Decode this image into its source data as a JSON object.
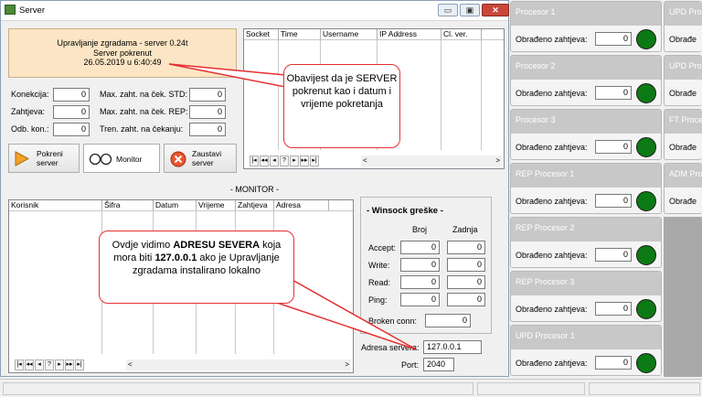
{
  "window": {
    "title": "Server",
    "minimize": "▭",
    "maximize": "▣",
    "close": "✕"
  },
  "status": {
    "line1": "Upravljanje zgradama - server 0.24t",
    "line2": "Server pokrenut",
    "line3": "26.05.2019 u  6:40:49"
  },
  "counters": {
    "konekcija_label": "Konekcija:",
    "konekcija": "0",
    "zahtjeva_label": "Zahtjeva:",
    "zahtjeva": "0",
    "odb_label": "Odb. kon.:",
    "odb": "0",
    "max_std_label": "Max. zaht. na ček. STD:",
    "max_std": "0",
    "max_rep_label": "Max. zaht. na ček. REP:",
    "max_rep": "0",
    "tren_label": "Tren. zaht. na čekanju:",
    "tren": "0"
  },
  "buttons": {
    "start": "Pokreni server",
    "monitor": "Monitor",
    "stop": "Zaustavi server"
  },
  "socket_grid": {
    "columns": [
      "Socket",
      "Time",
      "Username",
      "IP Address",
      "Cl. ver."
    ]
  },
  "monitor": {
    "title": "- MONITOR -",
    "columns": [
      "Korisnik",
      "Šifra",
      "Datum",
      "Vrijeme",
      "Zahtjeva",
      "Adresa"
    ]
  },
  "navigator": [
    "|◂",
    "◂◂",
    "◂",
    "?",
    "▸",
    "▸▸",
    "▸|"
  ],
  "winsock": {
    "title": "- Winsock greške -",
    "col_broj": "Broj",
    "col_zadnja": "Zadnja",
    "rows": [
      {
        "label": "Accept:",
        "broj": "0",
        "zadnja": "0"
      },
      {
        "label": "Write:",
        "broj": "0",
        "zadnja": "0"
      },
      {
        "label": "Read:",
        "broj": "0",
        "zadnja": "0"
      },
      {
        "label": "Ping:",
        "broj": "0",
        "zadnja": "0"
      }
    ],
    "broken_label": "Broken conn:",
    "broken": "0"
  },
  "server_address": {
    "label": "Adresa servera:",
    "value": "127.0.0.1",
    "port_label": "Port:",
    "port": "2040"
  },
  "callouts": {
    "top": "Obavijest da je SERVER pokrenut kao i datum i vrijeme pokretanja",
    "bottom_pre": "Ovdje vidimo ",
    "bottom_bold1": "ADRESU SEVERA",
    "bottom_mid": " koja mora biti ",
    "bottom_bold2": "127.0.0.1",
    "bottom_post": " ako je Upravljanje zgradama instalirano lokalno"
  },
  "processors_col1": [
    {
      "name": "Procesor 1",
      "label": "Obrađeno zahtjeva:",
      "value": "0"
    },
    {
      "name": "Procesor 2",
      "label": "Obrađeno zahtjeva:",
      "value": "0"
    },
    {
      "name": "Procesor 3",
      "label": "Obrađeno zahtjeva:",
      "value": "0"
    },
    {
      "name": "REP Procesor 1",
      "label": "Obrađeno zahtjeva:",
      "value": "0"
    },
    {
      "name": "REP Procesor 2",
      "label": "Obrađeno zahtjeva:",
      "value": "0"
    },
    {
      "name": "REP Procesor 3",
      "label": "Obrađeno zahtjeva:",
      "value": "0"
    },
    {
      "name": "UPD Procesor 1",
      "label": "Obrađeno zahtjeva:",
      "value": "0"
    }
  ],
  "processors_col2": [
    {
      "name": "UPD Pro",
      "label": "Obrađe"
    },
    {
      "name": "UPD Pro",
      "label": "Obrađe"
    },
    {
      "name": "FT Proce",
      "label": "Obrađe"
    },
    {
      "name": "ADM Pro",
      "label": "Obrađe"
    }
  ],
  "colors": {
    "led": "#0b7a14",
    "callout_border": "#e53030",
    "status_bg": "#fbe5c4"
  }
}
